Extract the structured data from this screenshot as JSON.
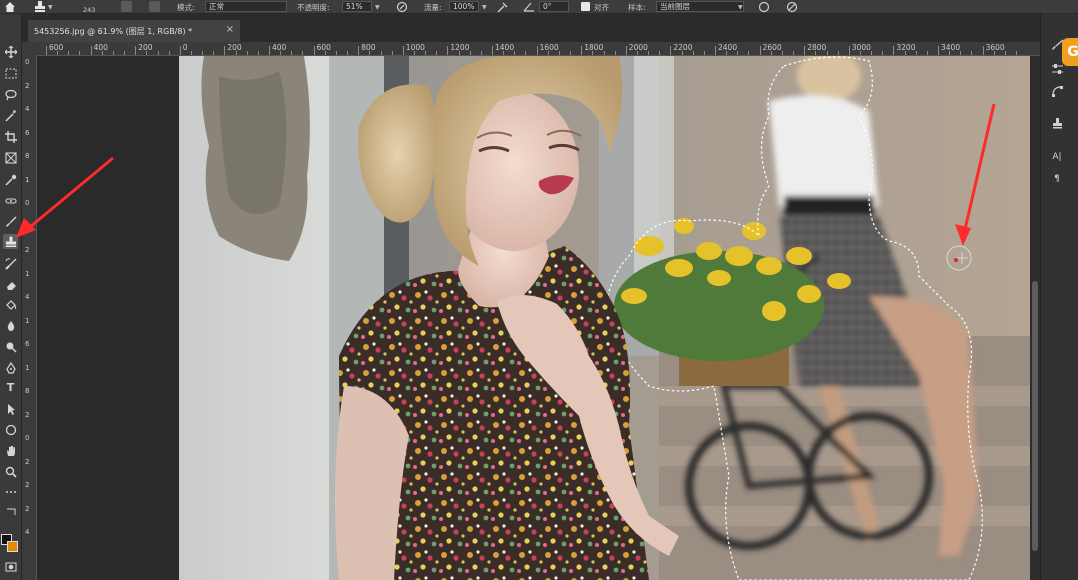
{
  "options_bar": {
    "brush_size": "243",
    "mode_label": "模式:",
    "mode_value": "正常",
    "opacity_label": "不透明度:",
    "opacity_value": "51%",
    "flow_label": "流量:",
    "flow_value": "100%",
    "angle_value": "0°",
    "aligned_label": "对齐",
    "sample_label": "样本:",
    "sample_value": "当前图层"
  },
  "document": {
    "tab_title": "5453256.jpg @ 61.9% (图层 1, RGB/8) *",
    "close_symbol": "×"
  },
  "ruler_top": [
    "600",
    "400",
    "200",
    "0",
    "200",
    "400",
    "600",
    "800",
    "1000",
    "1200",
    "1400",
    "1600",
    "1800",
    "2000",
    "2200",
    "2400",
    "2600",
    "2800",
    "3000",
    "3200",
    "3400",
    "3600"
  ],
  "ruler_left": [
    "0",
    "2",
    "4",
    "6",
    "8",
    "1",
    "0",
    "1",
    "2",
    "1",
    "4",
    "1",
    "6",
    "1",
    "8",
    "2",
    "0",
    "2",
    "2",
    "2",
    "4"
  ],
  "toolbar": {
    "tools": [
      "move-icon",
      "marquee-icon",
      "lasso-icon",
      "magic-wand-icon",
      "crop-icon",
      "frame-icon",
      "eyedropper-icon",
      "healing-icon",
      "brush-icon",
      "clone-stamp-icon",
      "history-brush-icon",
      "eraser-icon",
      "paint-bucket-icon",
      "blur-icon",
      "dodge-icon",
      "pen-icon",
      "type-icon",
      "path-select-icon",
      "shape-icon",
      "hand-icon",
      "zoom-icon",
      "more-icon"
    ],
    "active_tool": "clone-stamp-icon",
    "foreground_color": "#111111",
    "background_color": "#e08a00",
    "type_glyph": "T"
  },
  "right_panel": {
    "icons": [
      "brush-settings-icon",
      "adjust-icon",
      "paths-icon",
      "clone-source-icon",
      "character-icon",
      "paragraph-icon"
    ],
    "character_glyph": "A|",
    "paragraph_glyph": "¶",
    "help_glyph": "G"
  },
  "annotations": {
    "arrow_color": "#ff2a2a"
  }
}
